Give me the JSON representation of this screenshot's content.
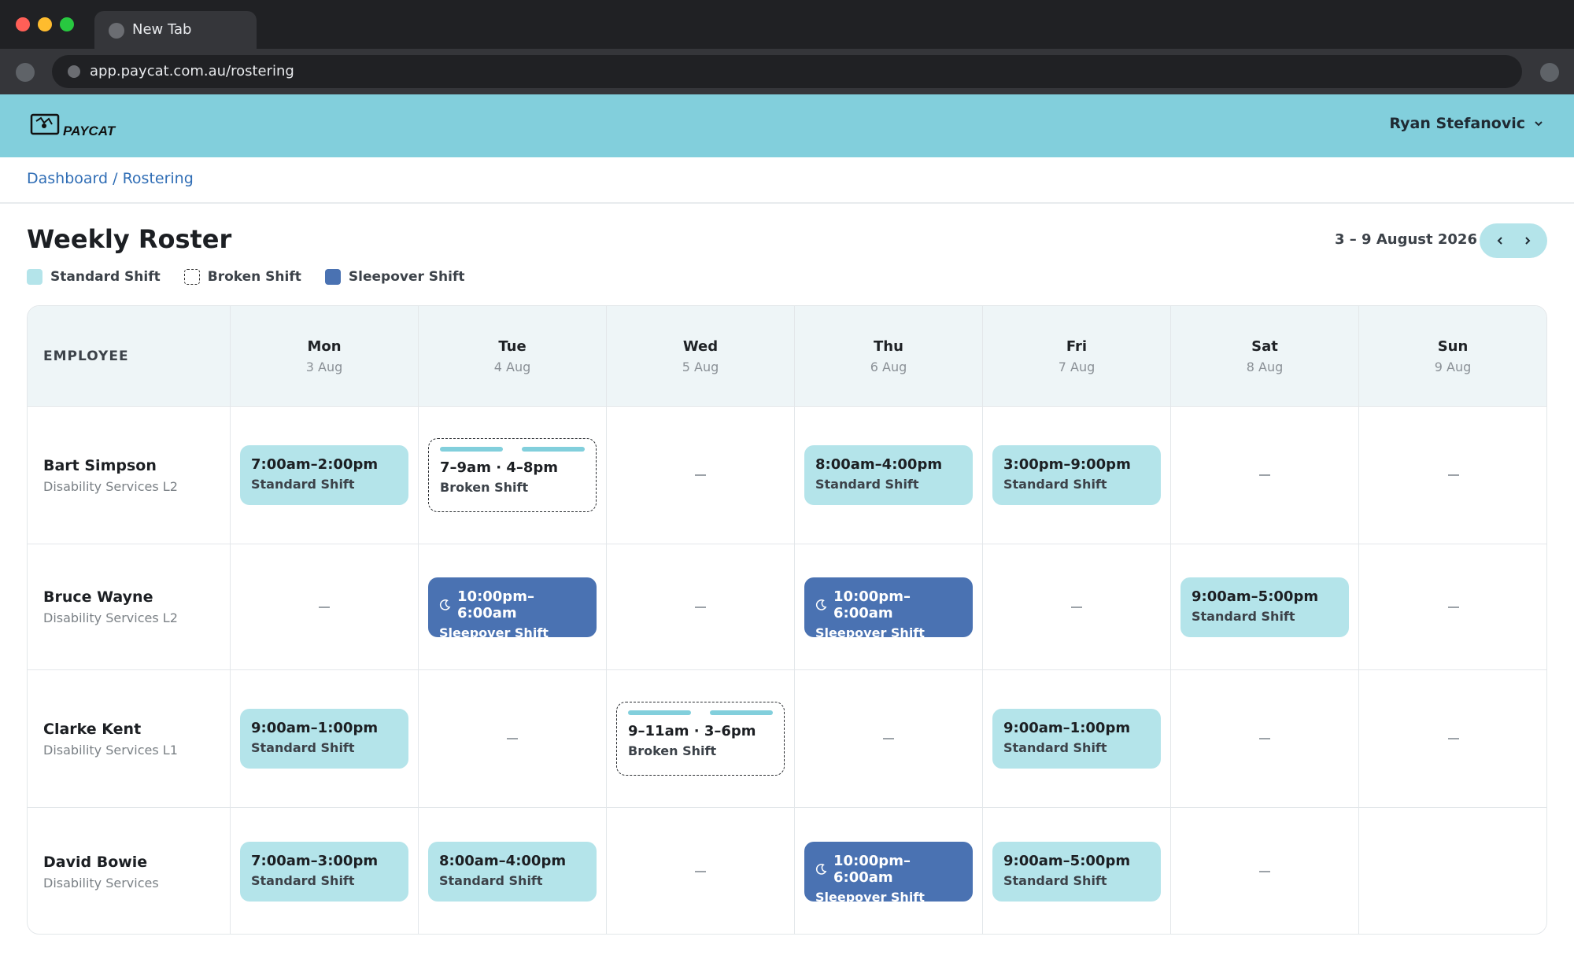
{
  "browser": {
    "tab_title": "New Tab",
    "url": "app.paycat.com.au/rostering"
  },
  "app": {
    "logo_text": "PAYCAT",
    "user_name": "Ryan Stefanovic",
    "breadcrumb": {
      "home": "Dashboard",
      "separator": " / ",
      "current": "Rostering"
    },
    "page_title": "Weekly Roster",
    "date_range": "3 – 9 August 2026"
  },
  "legend": [
    {
      "kind": "standard",
      "label": "Standard Shift"
    },
    {
      "kind": "broken",
      "label": "Broken Shift"
    },
    {
      "kind": "sleepover",
      "label": "Sleepover Shift"
    }
  ],
  "roster": {
    "employee_header": "EMPLOYEE",
    "days": [
      {
        "name": "Mon",
        "date": "3 Aug"
      },
      {
        "name": "Tue",
        "date": "4 Aug"
      },
      {
        "name": "Wed",
        "date": "5 Aug"
      },
      {
        "name": "Thu",
        "date": "6 Aug"
      },
      {
        "name": "Fri",
        "date": "7 Aug"
      },
      {
        "name": "Sat",
        "date": "8 Aug"
      },
      {
        "name": "Sun",
        "date": "9 Aug"
      }
    ],
    "employees": [
      {
        "name": "Bart Simpson",
        "role": "Disability Services L2",
        "shifts": [
          {
            "kind": "standard",
            "time": "7:00am–2:00pm",
            "type": "Standard Shift"
          },
          {
            "kind": "broken",
            "time": "7–9am · 4–8pm",
            "type": "Broken Shift"
          },
          null,
          {
            "kind": "standard",
            "time": "8:00am–4:00pm",
            "type": "Standard Shift"
          },
          {
            "kind": "standard",
            "time": "3:00pm–9:00pm",
            "type": "Standard Shift"
          },
          null,
          null
        ]
      },
      {
        "name": "Bruce Wayne",
        "role": "Disability Services L2",
        "shifts": [
          null,
          {
            "kind": "sleepover",
            "time": "10:00pm–6:00am",
            "type": "Sleepover Shift"
          },
          null,
          {
            "kind": "sleepover",
            "time": "10:00pm–6:00am",
            "type": "Sleepover Shift"
          },
          null,
          {
            "kind": "standard",
            "time": "9:00am–5:00pm",
            "type": "Standard Shift"
          },
          null
        ]
      },
      {
        "name": "Clarke Kent",
        "role": "Disability Services L1",
        "shifts": [
          {
            "kind": "standard",
            "time": "9:00am–1:00pm",
            "type": "Standard Shift"
          },
          null,
          {
            "kind": "broken",
            "time": "9–11am · 3–6pm",
            "type": "Broken Shift"
          },
          null,
          {
            "kind": "standard",
            "time": "9:00am–1:00pm",
            "type": "Standard Shift"
          },
          null,
          null
        ]
      },
      {
        "name": "David Bowie",
        "role": "Disability Services",
        "shifts": [
          {
            "kind": "standard",
            "time": "7:00am–3:00pm",
            "type": "Standard Shift"
          },
          {
            "kind": "standard",
            "time": "8:00am–4:00pm",
            "type": "Standard Shift"
          },
          null,
          {
            "kind": "sleepover",
            "time": "10:00pm–6:00am",
            "type": "Sleepover Shift"
          },
          {
            "kind": "standard",
            "time": "9:00am–5:00pm",
            "type": "Standard Shift"
          },
          null,
          "blank"
        ]
      }
    ]
  },
  "colors": {
    "header_bg": "#82cfdc",
    "standard": "#b4e4ea",
    "sleepover": "#4a72b2",
    "link": "#2f6db5"
  },
  "icons": {
    "user_menu": "chevron-down-icon",
    "prev": "chevron-left-icon",
    "next": "chevron-right-icon",
    "sleepover": "moon-icon"
  }
}
